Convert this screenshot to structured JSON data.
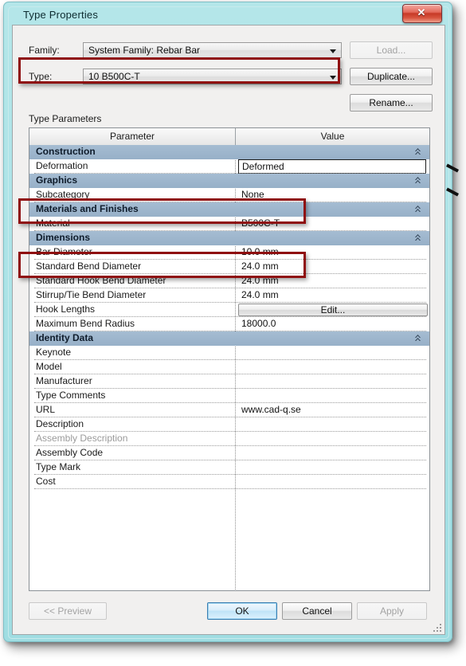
{
  "window": {
    "title": "Type Properties",
    "close_icon": "close-icon",
    "close_glyph": "✕"
  },
  "form": {
    "family_label": "Family:",
    "family_value": "System Family: Rebar Bar",
    "type_label": "Type:",
    "type_value": "10 B500C-T",
    "load_label": "Load...",
    "duplicate_label": "Duplicate...",
    "rename_label": "Rename..."
  },
  "table": {
    "caption": "Type Parameters",
    "columns": [
      "Parameter",
      "Value"
    ],
    "collapse_icon": "chevron-double-up-icon",
    "rows": [
      {
        "kind": "section",
        "name": "Construction"
      },
      {
        "kind": "param",
        "name": "Deformation",
        "value": "Deformed",
        "style": "focused-combo"
      },
      {
        "kind": "section",
        "name": "Graphics"
      },
      {
        "kind": "param",
        "name": "Subcategory",
        "value": "None"
      },
      {
        "kind": "section",
        "name": "Materials and Finishes"
      },
      {
        "kind": "param",
        "name": "Material",
        "value": "B500C-T"
      },
      {
        "kind": "section",
        "name": "Dimensions"
      },
      {
        "kind": "param",
        "name": "Bar Diameter",
        "value": "10.0 mm"
      },
      {
        "kind": "param",
        "name": "Standard Bend Diameter",
        "value": "24.0 mm"
      },
      {
        "kind": "param",
        "name": "Standard Hook Bend Diameter",
        "value": "24.0 mm"
      },
      {
        "kind": "param",
        "name": "Stirrup/Tie Bend Diameter",
        "value": "24.0 mm"
      },
      {
        "kind": "param",
        "name": "Hook Lengths",
        "value": "Edit...",
        "style": "button"
      },
      {
        "kind": "param",
        "name": "Maximum Bend Radius",
        "value": "18000.0"
      },
      {
        "kind": "section",
        "name": "Identity Data"
      },
      {
        "kind": "param",
        "name": "Keynote",
        "value": ""
      },
      {
        "kind": "param",
        "name": "Model",
        "value": ""
      },
      {
        "kind": "param",
        "name": "Manufacturer",
        "value": ""
      },
      {
        "kind": "param",
        "name": "Type Comments",
        "value": ""
      },
      {
        "kind": "param",
        "name": "URL",
        "value": "www.cad-q.se"
      },
      {
        "kind": "param",
        "name": "Description",
        "value": ""
      },
      {
        "kind": "param",
        "name": "Assembly Description",
        "value": "",
        "disabled": true
      },
      {
        "kind": "param",
        "name": "Assembly Code",
        "value": ""
      },
      {
        "kind": "param",
        "name": "Type Mark",
        "value": ""
      },
      {
        "kind": "param",
        "name": "Cost",
        "value": ""
      }
    ]
  },
  "footer": {
    "preview_label": "<< Preview",
    "ok_label": "OK",
    "cancel_label": "Cancel",
    "apply_label": "Apply"
  },
  "colors": {
    "annotation": "#8f0f10",
    "section_header": "#9cb5cd",
    "titlebar": "#aee3e7",
    "default_button_border": "#3c7fb1"
  }
}
